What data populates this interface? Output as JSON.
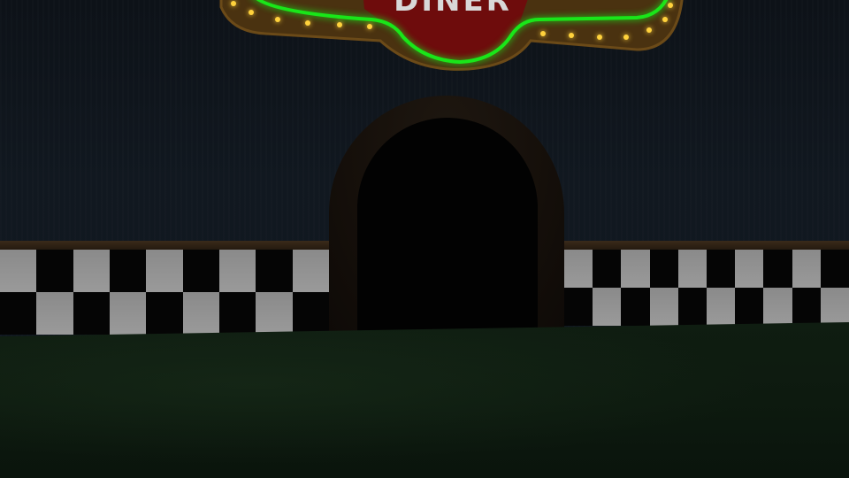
{
  "scene": {
    "sign_text": "DINER",
    "colors": {
      "neon": "#19e619",
      "sign_red": "#7a0d0d",
      "sign_wood": "#5a3a12",
      "bulb": "#ffd23c",
      "wall": "#111820",
      "floor": "#0d1a0f",
      "checker_light": "#929292",
      "checker_dark": "#050505"
    },
    "checker": {
      "left_columns": 9,
      "right_columns": 10,
      "rows": 2
    }
  }
}
